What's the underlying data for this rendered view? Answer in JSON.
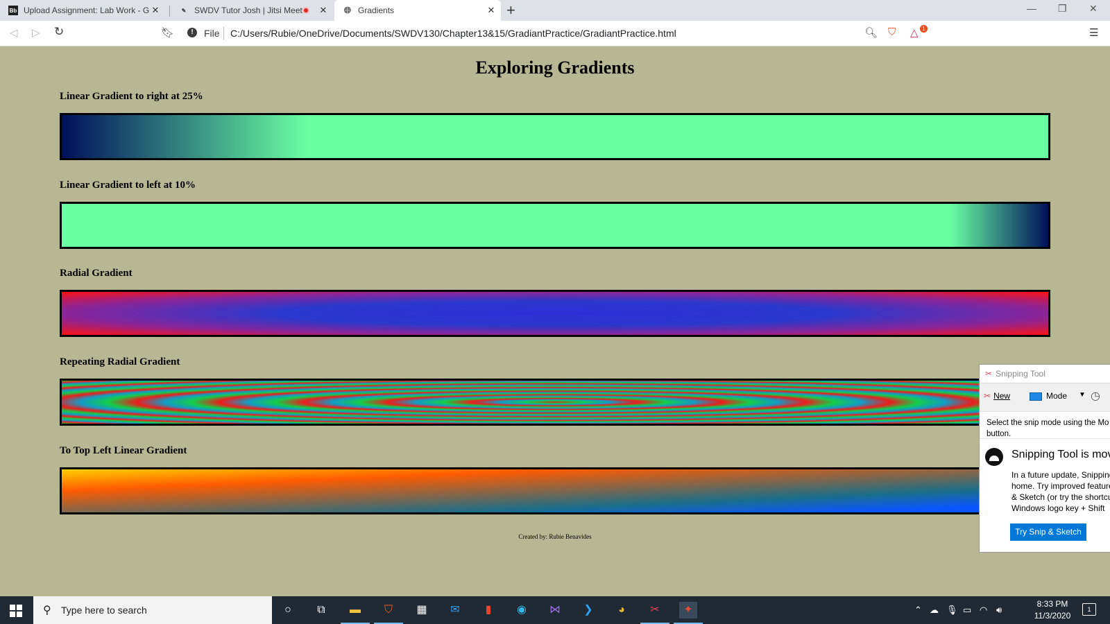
{
  "browser": {
    "tabs": [
      {
        "label": "Upload Assignment: Lab Work - Gr",
        "favicon": "Bb",
        "close": "✕"
      },
      {
        "label": "SWDV Tutor Josh | Jitsi Meet",
        "close": "✕"
      },
      {
        "label": "Gradients",
        "close": "✕"
      }
    ],
    "new_tab": "+",
    "window_controls": [
      "—",
      "❐",
      "✕"
    ],
    "address": {
      "scheme_label": "File",
      "url": "C:/Users/Rubie/OneDrive/Documents/SWDV130/Chapter13&15/GradiantPractice/GradiantPractice.html"
    },
    "brave_badge_count": "1"
  },
  "page": {
    "title": "Exploring Gradients",
    "sections": [
      {
        "heading": "Linear Gradient to right at 25%"
      },
      {
        "heading": "Linear Gradient to left at 10%"
      },
      {
        "heading": "Radial Gradient"
      },
      {
        "heading": "Repeating Radial Gradient"
      },
      {
        "heading": "To Top Left Linear Gradient"
      }
    ],
    "credit": "Created by: Rubie Benavides",
    "colors": {
      "background": "#b7b893",
      "navy": "#00105a",
      "mint": "#6bffa4",
      "red": "#ff1010",
      "blue": "#2f2fd6",
      "green": "#14cc47",
      "orange": "#ff5b00",
      "yellow": "#ffd000"
    }
  },
  "snipping_tool": {
    "title": "Snipping Tool",
    "new_label": "New",
    "mode_label": "Mode",
    "description_line1": "Select the snip mode using the Mo",
    "description_line2": "button.",
    "notice_heading": "Snipping Tool is mov",
    "notice_line1": "In a future update, Snipping",
    "notice_line2": "home. Try improved feature",
    "notice_line3": "& Sketch (or try the shortcu",
    "notice_line4": "Windows logo key + Shift",
    "try_button": "Try Snip & Sketch"
  },
  "taskbar": {
    "search_placeholder": "Type here to search",
    "time": "8:33 PM",
    "date": "11/3/2020",
    "notification_count": "1"
  }
}
